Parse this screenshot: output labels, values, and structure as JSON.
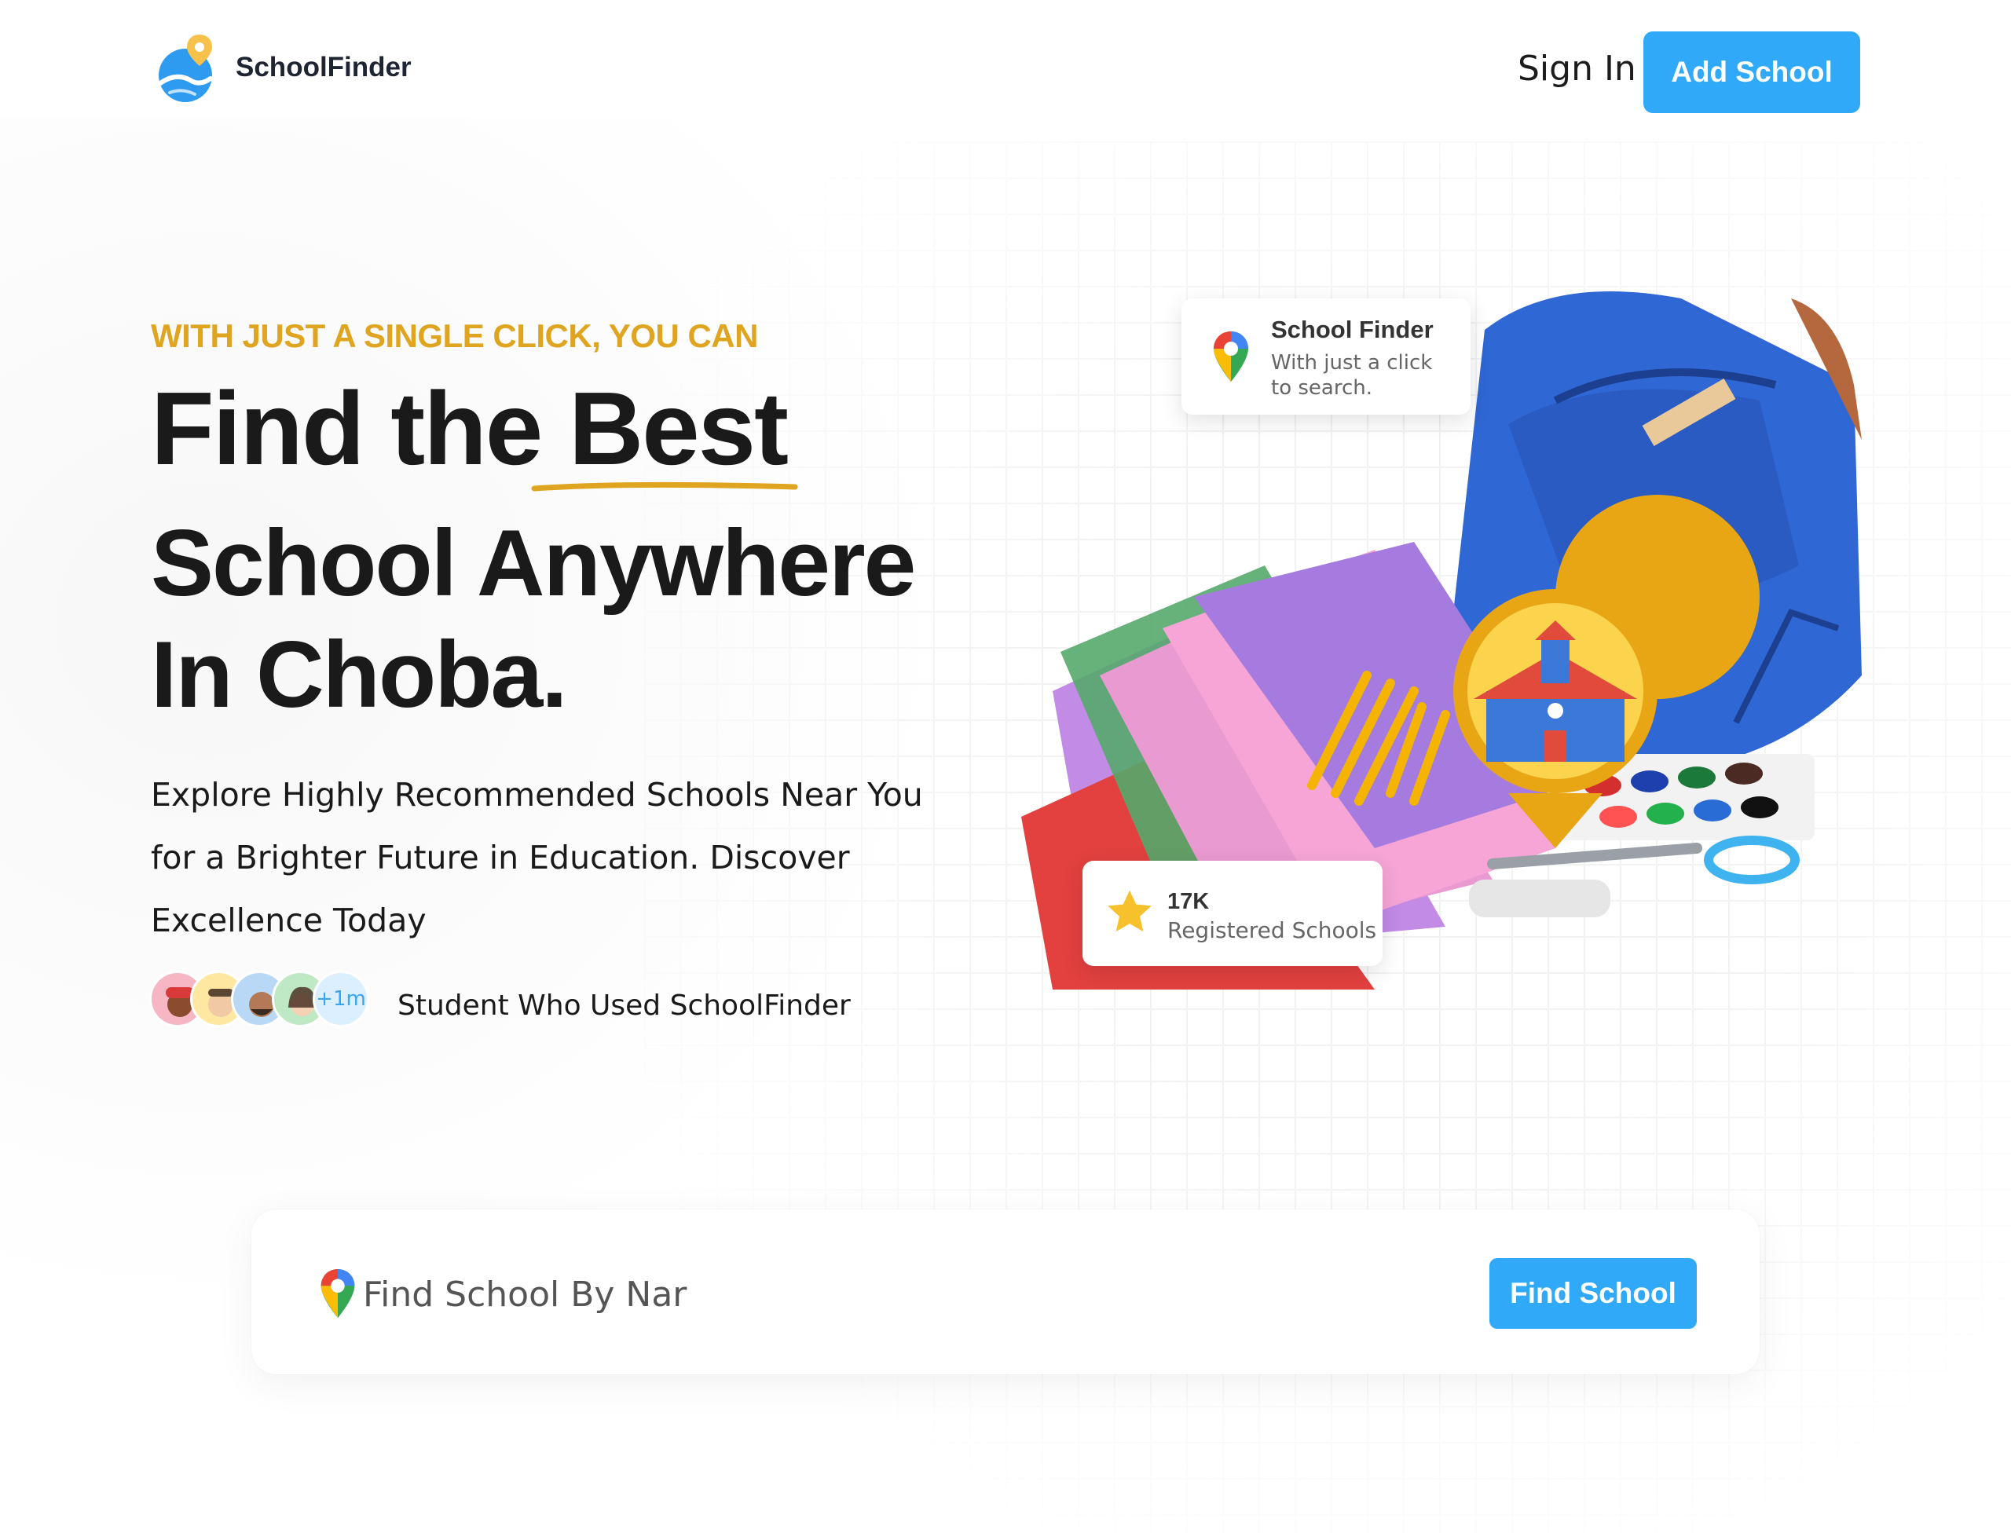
{
  "header": {
    "brand": "SchoolFinder",
    "sign_in": "Sign In",
    "add_school": "Add School"
  },
  "hero": {
    "eyebrow": "WITH JUST A SINGLE CLICK, YOU CAN",
    "headline_1": "Find the Best",
    "headline_2": "School Anywhere",
    "headline_3": "In Choba.",
    "description": "Explore Highly Recommended Schools Near You for a Brighter Future in Education. Discover Excellence Today",
    "avatars_more": "+1m",
    "students_label": "Student Who Used SchoolFinder"
  },
  "cards": {
    "finder_title": "School Finder",
    "finder_sub": "With just a click to search.",
    "registered_count": "17K",
    "registered_label": "Registered Schools"
  },
  "search": {
    "value": "Find School By Nar",
    "button": "Find School"
  },
  "icons": {
    "logo": "map-pin-globe-icon",
    "maps_pin": "map-pin-icon",
    "star": "star-icon",
    "school_pin": "school-pin-icon"
  },
  "colors": {
    "accent": "#2fa9f8",
    "eyebrow": "#e0a520",
    "text": "#1a1a1a"
  }
}
